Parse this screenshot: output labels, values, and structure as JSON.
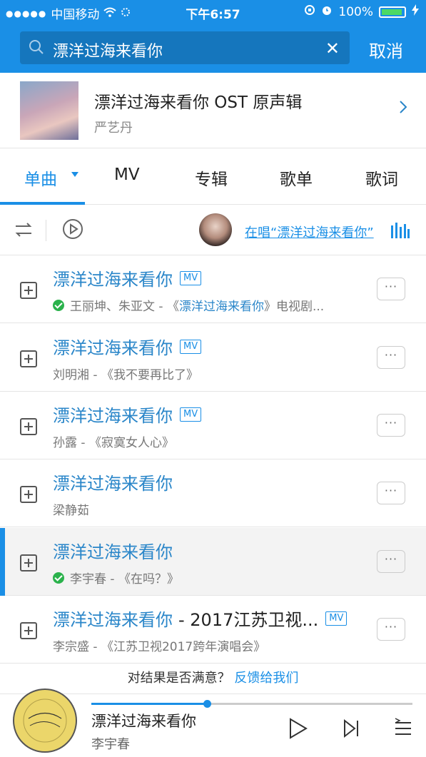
{
  "status": {
    "carrier": "中国移动",
    "time": "下午6:57",
    "battery": "100%"
  },
  "search": {
    "query": "漂洋过海来看你",
    "cancel_label": "取消"
  },
  "album": {
    "title": "漂洋过海来看你 OST 原声辑",
    "artist": "严艺丹"
  },
  "tabs": [
    {
      "label": "单曲"
    },
    {
      "label": "MV"
    },
    {
      "label": "专辑"
    },
    {
      "label": "歌单"
    },
    {
      "label": "歌词"
    }
  ],
  "toolbar": {
    "singing_link": "在唱“漂洋过海来看你”"
  },
  "songs": [
    {
      "title": "漂洋过海来看你",
      "title_extra": "",
      "mv": "MV",
      "artist_prefix": "王丽坤、朱亚文 - 《",
      "album_highlight": "漂洋过海来看你",
      "album_suffix": "》电视剧...",
      "downloaded": true
    },
    {
      "title": "漂洋过海来看你",
      "title_extra": "",
      "mv": "MV",
      "subtitle": "刘明湘 - 《我不要再比了》",
      "downloaded": false
    },
    {
      "title": "漂洋过海来看你",
      "title_extra": "",
      "mv": "MV",
      "subtitle": "孙露 - 《寂寞女人心》",
      "downloaded": false
    },
    {
      "title": "漂洋过海来看你",
      "title_extra": "",
      "mv": "",
      "subtitle": "梁静茹",
      "downloaded": false
    },
    {
      "title": "漂洋过海来看你",
      "title_extra": "",
      "mv": "",
      "subtitle": "李宇春 - 《在吗？》",
      "downloaded": true,
      "playing": true
    },
    {
      "title": "漂洋过海来看你",
      "title_extra": "- 2017江苏卫视...",
      "mv": "MV",
      "subtitle": "李宗盛 - 《江苏卫视2017跨年演唱会》",
      "downloaded": false
    }
  ],
  "more_label": "···",
  "feedback": {
    "question": "对结果是否满意？",
    "link": "反馈给我们"
  },
  "player": {
    "title": "漂洋过海来看你",
    "artist": "李宇春",
    "progress": 0.36
  },
  "colors": {
    "accent": "#1a8fe6",
    "song_title": "#2a86c9",
    "downloaded_check": "#2bb24c"
  }
}
